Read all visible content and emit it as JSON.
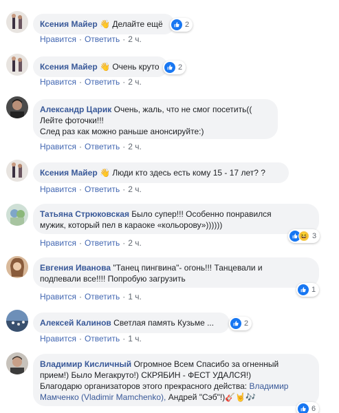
{
  "actions": {
    "like": "Нравится",
    "reply": "Ответить",
    "sep": "·"
  },
  "comments": [
    {
      "author": "Ксения Майер",
      "text": "Делайте ещё",
      "time": "2 ч.",
      "reactions": "2"
    },
    {
      "author": "Ксения Майер",
      "text": "Очень круто",
      "time": "2 ч.",
      "reactions": "2"
    },
    {
      "author": "Александр Царик",
      "text_line1": "Очень, жаль, что не смог посетить((",
      "text_line2": "Лейте фоточки!!!",
      "text_line3": "След раз как можно раньше анонсируйте:)",
      "time": "2 ч."
    },
    {
      "author": "Ксения Майер",
      "text": "Люди кто здесь есть кому 15 - 17 лет? ?",
      "time": "2 ч."
    },
    {
      "author": "Татьяна Стрюковская",
      "text_line1": "Было супер!!! Особенно понравился",
      "text_line2": "мужик, который пел в караоке «кольорову»))))))",
      "time": "2 ч.",
      "reactions": "3"
    },
    {
      "author": "Евгения Иванова",
      "text_line1": "\"Танец пингвина\"- огонь!!! Танцевали и",
      "text_line2": "подпевали все!!!! Попробую загрузить",
      "time": "1 ч.",
      "reactions": "1"
    },
    {
      "author": "Алексей Калинов",
      "text": "Светлая память Кузьме ...",
      "time": "1 ч.",
      "reactions": "2"
    },
    {
      "author": "Владимир Кисличный",
      "text_line1": "Огромное Всем Спасибо за огненный",
      "text_line2": "прием!) Было Мегакруто!) СКРЯБИН - ФЕСТ УДАЛСЯ!)",
      "text_line3": "Благодарю организаторов этого прекрасного действа:",
      "link1": "Владимир",
      "link2": "Мамченко (Vladimir Mamchenko),",
      "text_tail": "Андрей \"Сэб\"!)",
      "reactions": "6"
    }
  ],
  "colors": {
    "link": "#385898",
    "action": "#4267b2",
    "bubble": "#f2f3f5",
    "like": "#1877f2"
  }
}
